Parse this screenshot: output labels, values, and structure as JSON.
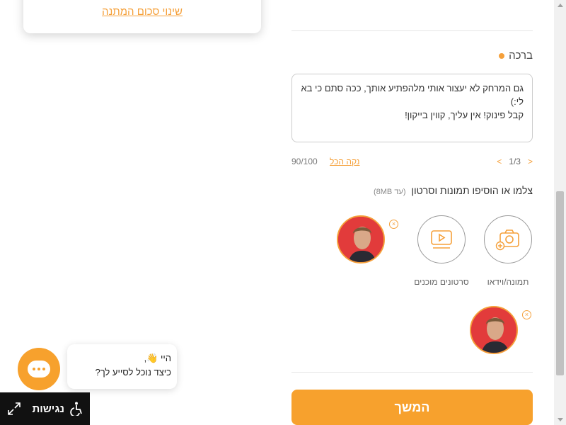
{
  "gift_amount": {
    "change_link": "שינוי סכום המתנה"
  },
  "greeting": {
    "label": "ברכה",
    "text_line1": "גם המרחק לא יעצור אותי מלהפתיע אותך, ככה סתם כי בא",
    "text_line2": "לי:)",
    "text_line3": "קבל פינוק! אין עליך, קווין בייקון!",
    "char_count": "90/100",
    "clear_label": "נקה הכל",
    "pager": {
      "current": "1/3",
      "prev": "<",
      "next": ">"
    }
  },
  "media": {
    "title": "צלמו או הוסיפו תמונות וסרטון",
    "size_hint": "(עד 8MB)",
    "buttons": [
      {
        "label": "תמונה/וידאו",
        "icon": "camera-plus-icon"
      },
      {
        "label": "סרטונים מוכנים",
        "icon": "video-play-icon"
      }
    ],
    "remove_symbol": "×"
  },
  "continue_button": "המשך",
  "chat": {
    "greeting_line": "היי 👋,",
    "question_line": "כיצד נוכל לסייע לך?"
  },
  "accessibility": {
    "label": "נגישות"
  },
  "colors": {
    "accent": "#f7a12d",
    "text": "#333333"
  }
}
